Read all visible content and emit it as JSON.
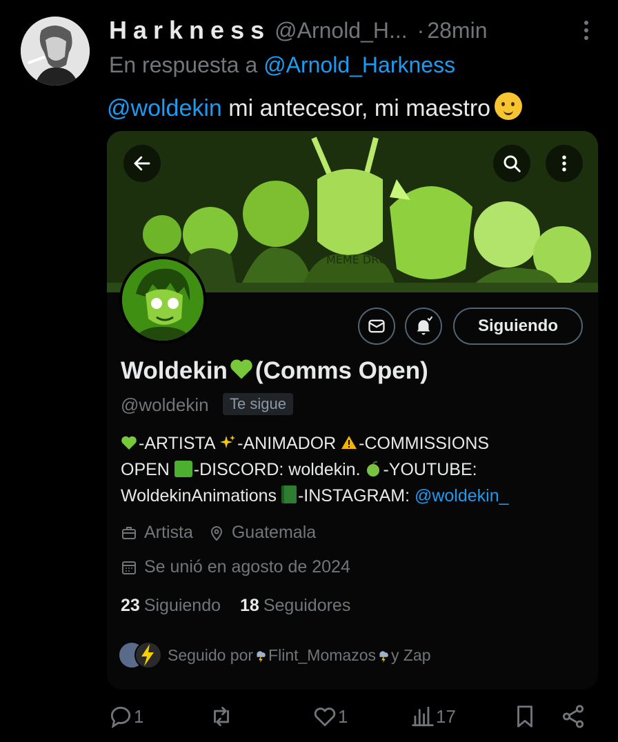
{
  "tweet": {
    "display_name": "Harkness",
    "handle": "@Arnold_H...",
    "separator": "·",
    "time": "28min",
    "reply_prefix": "En respuesta a",
    "reply_to": "@Arnold_Harkness",
    "mention": "@woldekin",
    "text": " mi antecesor, mi maestro"
  },
  "profile_card": {
    "name_part1": "Woldekin",
    "name_part2": "(Comms Open)",
    "handle": "@woldekin",
    "follows_you": "Te sigue",
    "follow_button": "Siguiendo",
    "banner_text": "MEME DROID",
    "bio": {
      "line1_a": "-ARTISTA ",
      "line1_b": "-ANIMADOR ",
      "line1_c": "-COMMISSIONS",
      "line2_a": "OPEN ",
      "line2_b": "-DISCORD: woldekin. ",
      "line2_c": "-YOUTUBE:",
      "line3_a": "WoldekinAnimations ",
      "line3_b": "-INSTAGRAM: ",
      "line3_link": "@woldekin_"
    },
    "profession": "Artista",
    "location": "Guatemala",
    "joined": "Se unió en agosto de 2024",
    "following_count": "23",
    "following_label": "Siguiendo",
    "followers_count": "18",
    "followers_label": "Seguidores",
    "followed_by_prefix": "Seguido por ",
    "followed_by_user": "Flint_Momazos",
    "followed_by_suffix": " y Zap"
  },
  "action_bar": {
    "reply_count": "1",
    "like_count": "1",
    "views_count": "17"
  },
  "colors": {
    "link": "#1d9bf0",
    "muted": "#71767b",
    "text": "#e7e9ea",
    "banner_green": "#3b7a16"
  }
}
